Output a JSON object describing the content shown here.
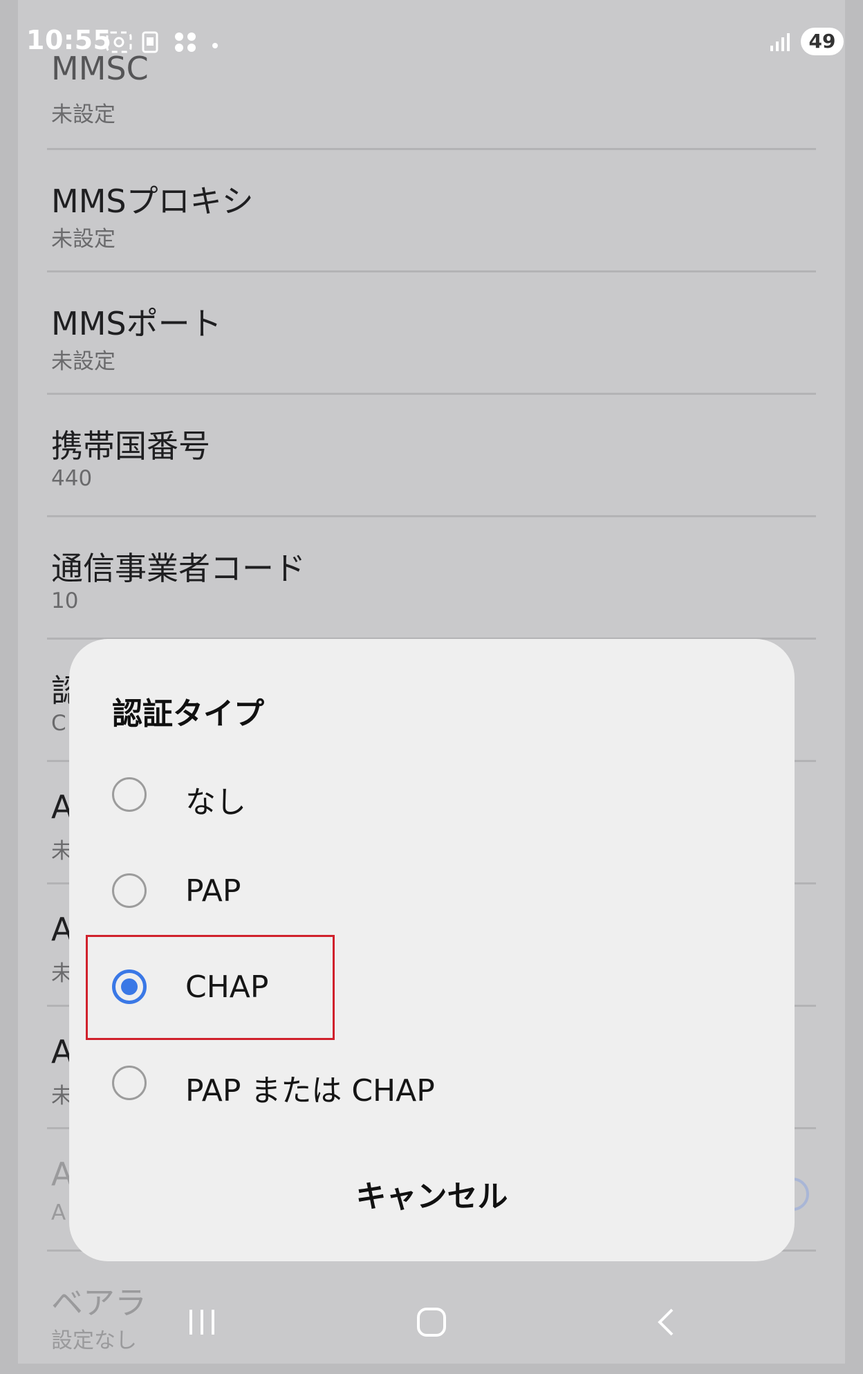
{
  "status_bar": {
    "time": "10:55",
    "battery": "49"
  },
  "settings_list": [
    {
      "title": "MMSC",
      "value": "未設定"
    },
    {
      "title": "MMSプロキシ",
      "value": "未設定"
    },
    {
      "title": "MMSポート",
      "value": "未設定"
    },
    {
      "title": "携帯国番号",
      "value": "440"
    },
    {
      "title": "通信事業者コード",
      "value": "10"
    },
    {
      "title": "認",
      "value": "C"
    },
    {
      "title": "A",
      "value": "未"
    },
    {
      "title": "A",
      "value": "未"
    },
    {
      "title": "A",
      "value": "未"
    },
    {
      "title": "A",
      "value": "A"
    },
    {
      "title": "ベアラ",
      "value": "設定なし"
    }
  ],
  "dialog": {
    "title": "認証タイプ",
    "options": [
      {
        "label": "なし",
        "selected": false
      },
      {
        "label": "PAP",
        "selected": false
      },
      {
        "label": "CHAP",
        "selected": true
      },
      {
        "label": "PAP または CHAP",
        "selected": false
      }
    ],
    "cancel_label": "キャンセル"
  },
  "colors": {
    "accent": "#3a78e6",
    "highlight_border": "#d0212c"
  }
}
